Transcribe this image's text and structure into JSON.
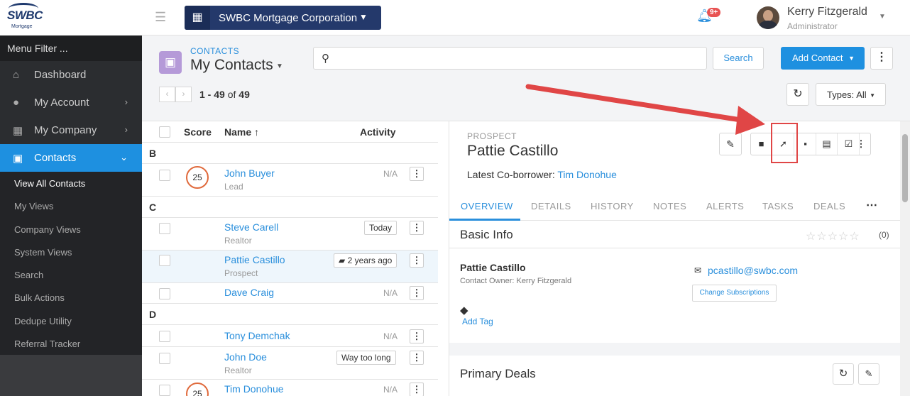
{
  "brand": {
    "logo_text": "SWBC",
    "logo_sub": "Mortgage"
  },
  "topbar": {
    "company": "SWBC Mortgage Corporation",
    "notifications_badge": "9+",
    "user_name": "Kerry Fitzgerald",
    "user_role": "Administrator"
  },
  "sidebar": {
    "filter": "Menu Filter ...",
    "items": [
      {
        "label": "Dashboard",
        "icon": "home-icon"
      },
      {
        "label": "My Account",
        "icon": "user-icon"
      },
      {
        "label": "My Company",
        "icon": "building-icon"
      },
      {
        "label": "Contacts",
        "icon": "contacts-icon"
      }
    ],
    "subitems": [
      "View All Contacts",
      "My Views",
      "Company Views",
      "System Views",
      "Search",
      "Bulk Actions",
      "Dedupe Utility",
      "Referral Tracker"
    ]
  },
  "header": {
    "crumb": "CONTACTS",
    "title": "My Contacts",
    "search_placeholder": "",
    "search_btn": "Search",
    "add_contact": "Add Contact",
    "count_range": "1 - 49",
    "count_of": "of",
    "count_total": "49",
    "types": "Types: All"
  },
  "list": {
    "col_score": "Score",
    "col_name": "Name ↑",
    "col_activity": "Activity",
    "groups": [
      "B",
      "C",
      "D"
    ],
    "rows": [
      {
        "name": "John Buyer",
        "type": "Lead",
        "score": "25",
        "activity": "N/A"
      },
      {
        "name": "Steve Carell",
        "type": "Realtor",
        "score": "",
        "activity": "Today"
      },
      {
        "name": "Pattie Castillo",
        "type": "Prospect",
        "score": "",
        "activity": "2 years ago"
      },
      {
        "name": "Dave Craig",
        "type": "",
        "score": "",
        "activity": "N/A"
      },
      {
        "name": "Tony Demchak",
        "type": "",
        "score": "",
        "activity": "N/A"
      },
      {
        "name": "John Doe",
        "type": "Realtor",
        "score": "",
        "activity": "Way too long"
      },
      {
        "name": "Tim Donohue",
        "type": "",
        "score": "25",
        "activity": "N/A"
      }
    ]
  },
  "detail": {
    "label": "PROSPECT",
    "name": "Pattie Castillo",
    "cob_label": "Latest Co-borrower:",
    "cob_name": "Tim Donohue",
    "tabs": [
      "OVERVIEW",
      "DETAILS",
      "HISTORY",
      "NOTES",
      "ALERTS",
      "TASKS",
      "DEALS"
    ],
    "basic_info": "Basic Info",
    "rating": "☆☆☆☆☆",
    "rating_count": "(0)",
    "contact_name": "Pattie Castillo",
    "owner": "Contact Owner: Kerry Fitzgerald",
    "email": "pcastillo@swbc.com",
    "change_subs": "Change Subscriptions",
    "add_tag": "Add Tag",
    "primary_deals": "Primary Deals"
  },
  "colors": {
    "accent": "#1e90e0",
    "brand": "#24396b",
    "annotation": "#e04646"
  }
}
